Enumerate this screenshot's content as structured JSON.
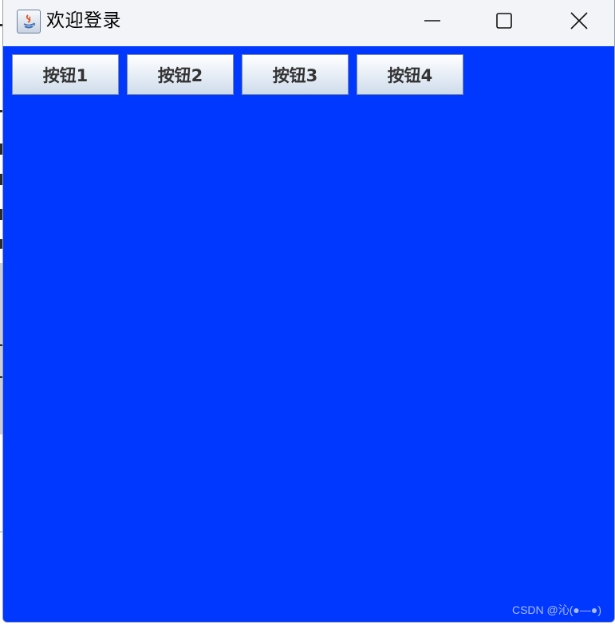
{
  "window": {
    "title": "欢迎登录",
    "content_background": "#0038ff",
    "titlebar_background": "#f2f4f8"
  },
  "window_controls": {
    "minimize_icon": "minimize-icon",
    "maximize_icon": "maximize-icon",
    "close_icon": "close-icon"
  },
  "buttons": [
    {
      "label": "按钮1"
    },
    {
      "label": "按钮2"
    },
    {
      "label": "按钮3"
    },
    {
      "label": "按钮4"
    }
  ],
  "watermark": "CSDN @沁(●—●)"
}
